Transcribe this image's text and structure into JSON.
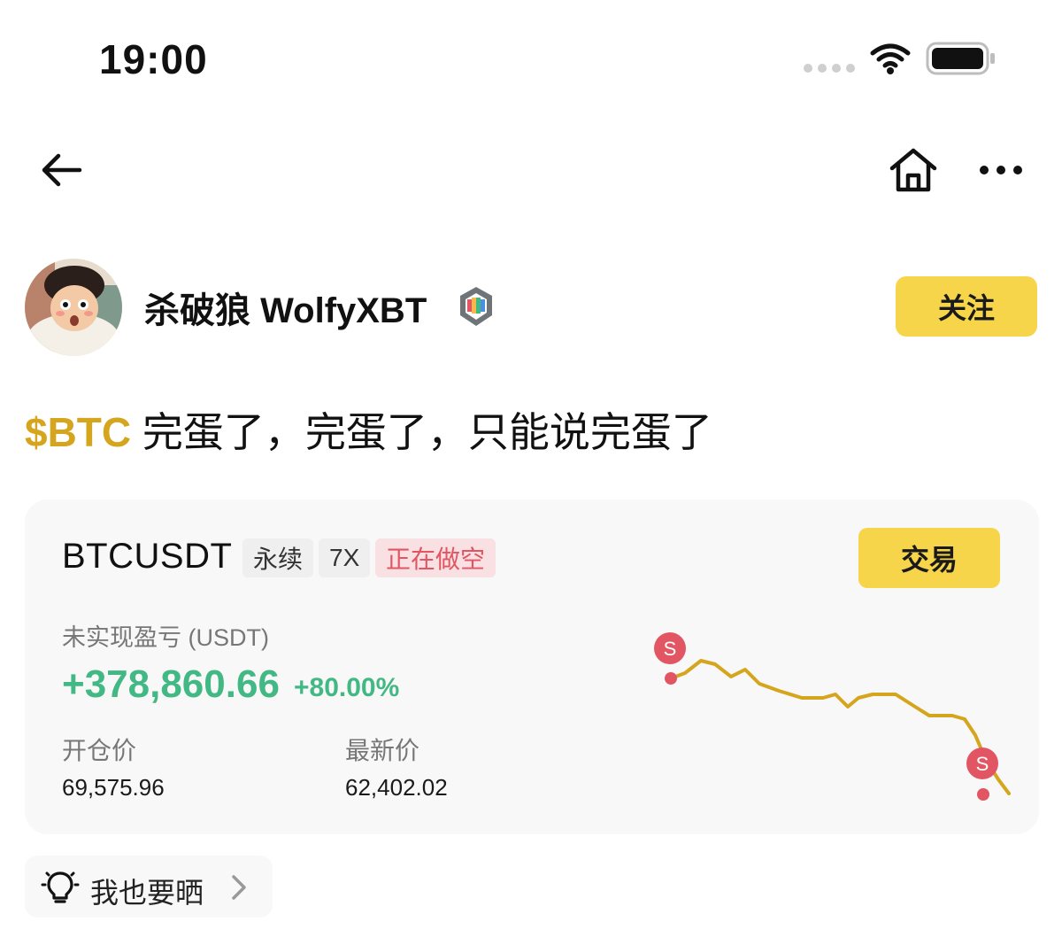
{
  "status_bar": {
    "time": "19:00",
    "icons": [
      "signal-dots-icon",
      "wifi-icon",
      "battery-icon"
    ]
  },
  "nav": {
    "icons": [
      "back-arrow-icon",
      "home-icon",
      "more-horizontal-icon"
    ]
  },
  "author": {
    "name": "杀破狼 WolfyXBT",
    "badge_icon": "verified-badge-icon",
    "follow_label": "关注"
  },
  "post": {
    "ticker": "$BTC",
    "text": " 完蛋了，完蛋了，只能说完蛋了"
  },
  "trade_card": {
    "pair": "BTCUSDT",
    "tag_perpetual": "永续",
    "leverage": "7X",
    "direction": "正在做空",
    "trade_label": "交易",
    "pnl_label": "未实现盈亏 (USDT)",
    "pnl_value": "+378,860.66",
    "pnl_percent": "+80.00%",
    "entry_label": "开仓价",
    "entry_value": "69,575.96",
    "last_label": "最新价",
    "last_value": "62,402.02",
    "marker_label": "S",
    "colors": {
      "profit": "#42b884",
      "short": "#e25562",
      "line": "#d6a51e",
      "accent": "#f6d54a"
    }
  },
  "share": {
    "icon": "lightbulb-icon",
    "label": "我也要晒",
    "chevron_icon": "chevron-right-icon"
  }
}
